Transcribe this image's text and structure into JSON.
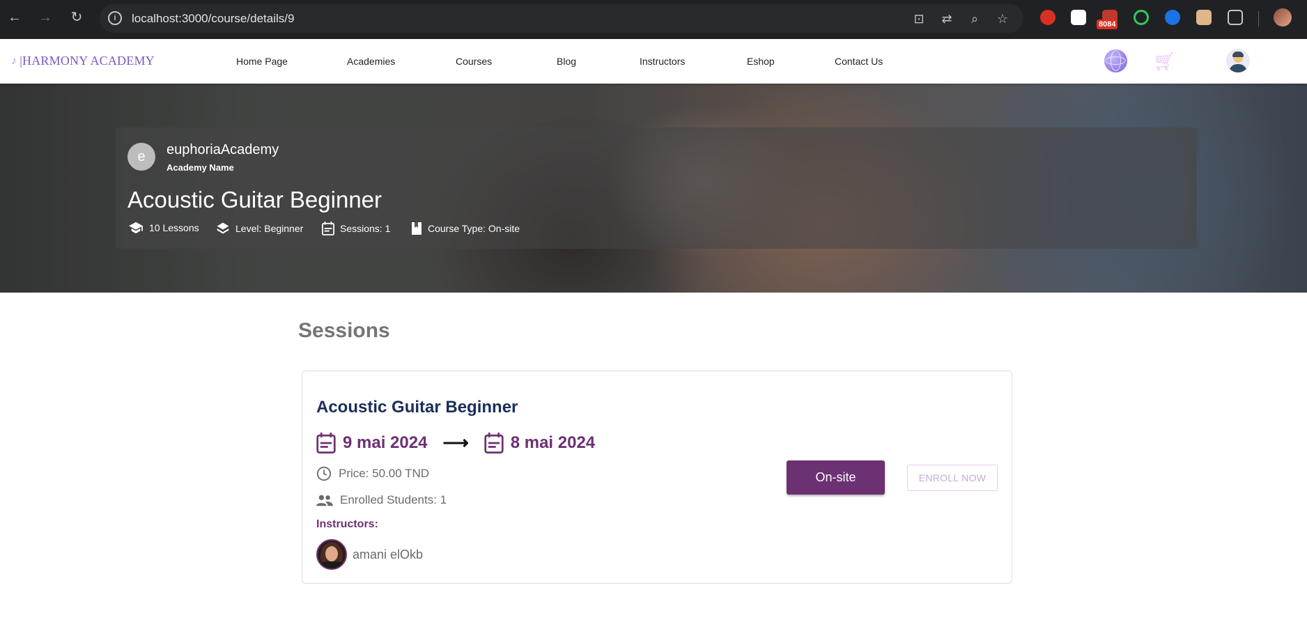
{
  "browser": {
    "url": "localhost:3000/course/details/9",
    "extension_badge": "8084"
  },
  "site": {
    "logo_text": "|HARMONY ACADEMY",
    "nav": [
      "Home Page",
      "Academies",
      "Courses",
      "Blog",
      "Instructors",
      "Eshop",
      "Contact Us"
    ]
  },
  "hero": {
    "academy_initial": "e",
    "academy_name": "euphoriaAcademy",
    "academy_sub": "Academy Name",
    "course_title": "Acoustic Guitar Beginner",
    "meta": {
      "lessons": "10 Lessons",
      "level": "Level: Beginner",
      "sessions": "Sessions: 1",
      "course_type": "Course Type: On-site"
    }
  },
  "sessions": {
    "heading": "Sessions",
    "card": {
      "title": "Acoustic Guitar Beginner",
      "start_date": "9 mai 2024",
      "arrow": "⟶",
      "end_date": "8 mai 2024",
      "price": "Price: 50.00 TND",
      "enrolled": "Enrolled Students: 1",
      "instructors_label": "Instructors:",
      "instructor_name": "amani elOkb",
      "type_button": "On-site",
      "enroll_button": "ENROLL NOW"
    }
  },
  "colors": {
    "accent": "#6c3173",
    "title_navy": "#1a2e5a",
    "logo_purple": "#7e57c2"
  }
}
